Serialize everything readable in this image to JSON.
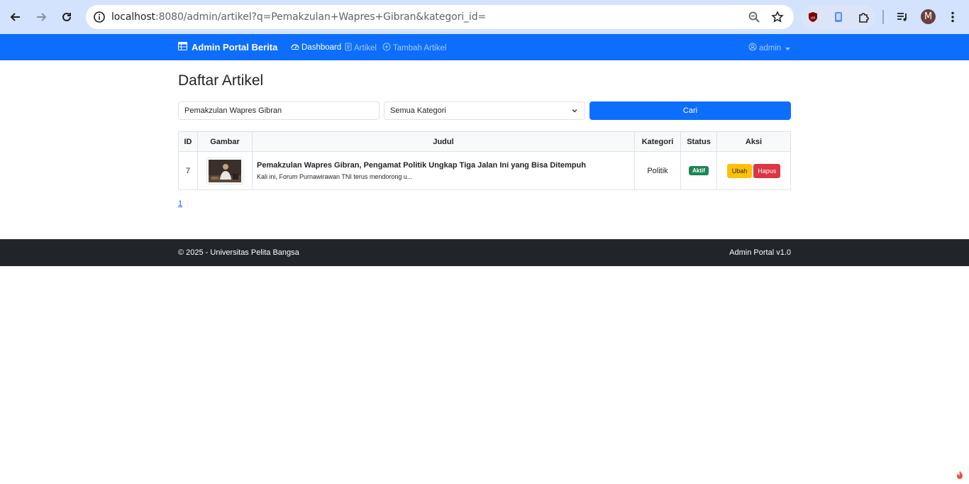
{
  "browser": {
    "url_host": "localhost",
    "url_rest": ":8080/admin/artikel?q=Pemakzulan+Wapres+Gibran&kategori_id=",
    "profile_initial": "M",
    "icons": [
      "back-icon",
      "forward-icon",
      "reload-icon",
      "site-info-icon",
      "zoom-icon",
      "bookmark-star-icon",
      "ublock-icon",
      "extension-phone-icon",
      "extensions-puzzle-icon",
      "media-queue-icon",
      "kebab-menu-icon"
    ]
  },
  "navbar": {
    "brand": "Admin Portal Berita",
    "links": [
      {
        "label": "Dashboard",
        "icon": "dashboard-icon"
      },
      {
        "label": "Artikel",
        "icon": "document-icon"
      },
      {
        "label": "Tambah Artikel",
        "icon": "plus-circle-icon"
      }
    ],
    "user": "admin"
  },
  "page": {
    "title": "Daftar Artikel",
    "search": {
      "value": "Pemakzulan Wapres Gibran"
    },
    "category_select": {
      "selected": "Semua Kategori"
    },
    "search_button": "Cari"
  },
  "table": {
    "headers": [
      "ID",
      "Gambar",
      "Judul",
      "Kategori",
      "Status",
      "Aksi"
    ],
    "rows": [
      {
        "id": "7",
        "title": "Pemakzulan Wapres Gibran, Pengamat Politik Ungkap Tiga Jalan Ini yang Bisa Ditempuh",
        "snippet": "Kali ini, Forum Purnawirawan TNI terus mendorong u...",
        "category": "Politik",
        "status": "Aktif",
        "edit_label": "Ubah",
        "delete_label": "Hapus"
      }
    ]
  },
  "pagination": {
    "current": "1"
  },
  "footer": {
    "left": "© 2025 - Universitas Pelita Bangsa",
    "right": "Admin Portal v1.0"
  },
  "colors": {
    "primary": "#0d6efd",
    "success": "#198754",
    "warning": "#ffc107",
    "danger": "#dc3545",
    "footer_bg": "#212529",
    "chrome_bg": "#d3e3fd"
  }
}
